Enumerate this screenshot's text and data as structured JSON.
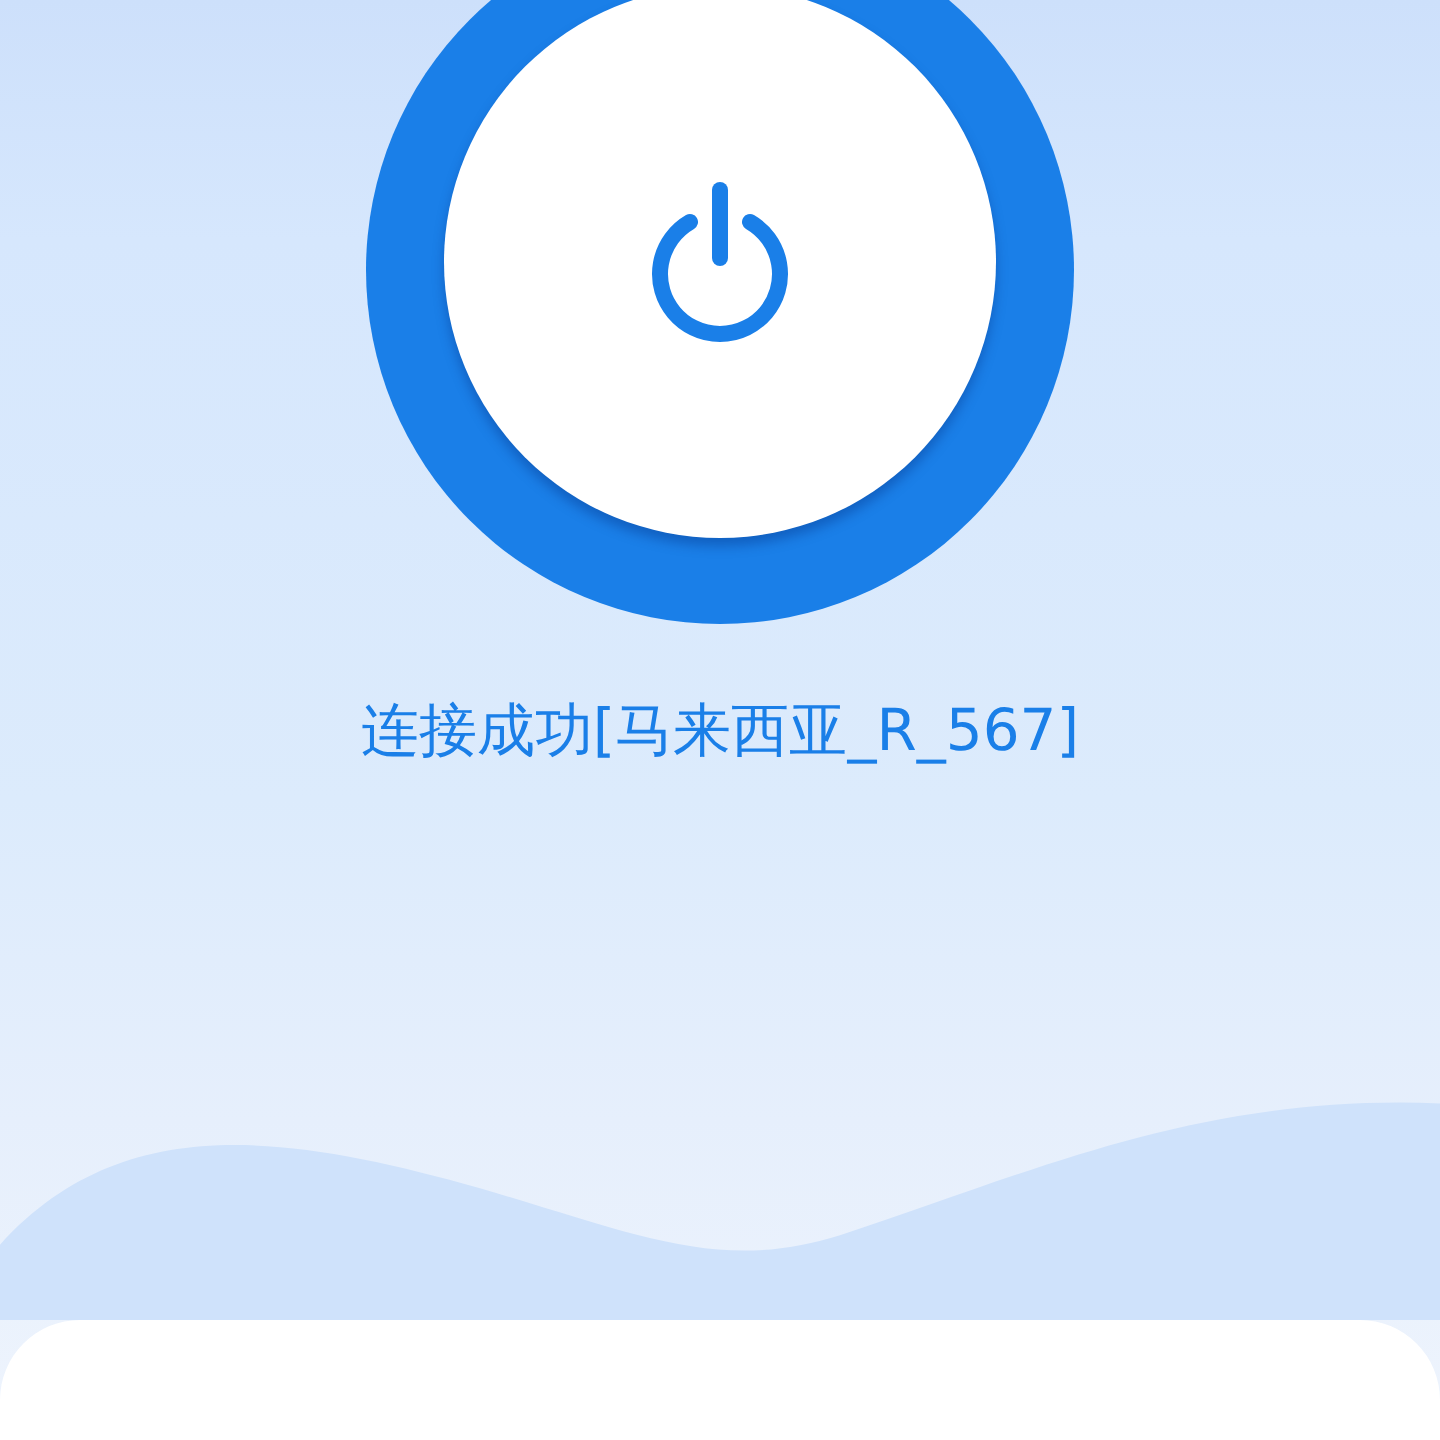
{
  "power_button": {
    "on": true
  },
  "status_text": "连接成功[马来西亚_R_567]"
}
